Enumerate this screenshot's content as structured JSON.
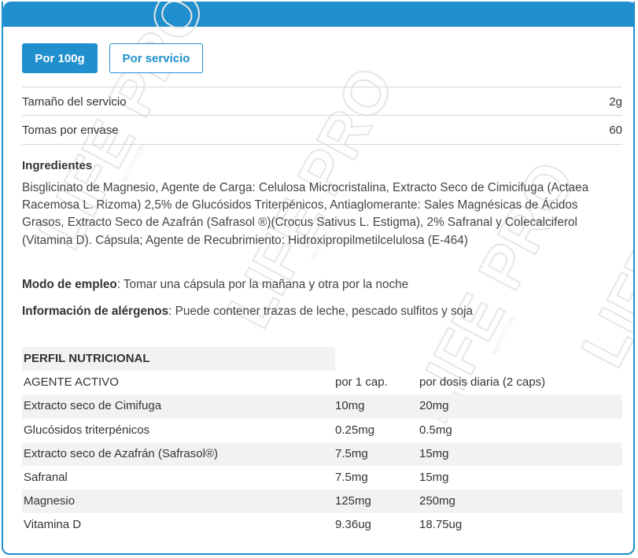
{
  "colors": {
    "accent": "#1f8fce",
    "row_alt": "#f2f2f2",
    "text": "#333333"
  },
  "tabs": [
    {
      "label": "Por 100g",
      "active": true
    },
    {
      "label": "Por servicio",
      "active": false
    }
  ],
  "serving": {
    "size_label": "Tamaño del servicio",
    "size_value": "2g",
    "doses_label": "Tomas por envase",
    "doses_value": "60"
  },
  "ingredients": {
    "heading": "Ingredientes",
    "text": "Bisglicinato de Magnesio, Agente de Carga: Celulosa Microcristalina, Extracto Seco de Cimicifuga (Actaea Racemosa L. Rizoma) 2,5% de Glucósidos Triterpénicos, Antiaglomerante: Sales Magnésicas de Ácidos Grasos, Extracto Seco de Azafrán (Safrasol ®)(Crocus Sativus L. Estigma), 2% Safranal y Colecalciferol (Vitamina D). Cápsula; Agente de Recubrimiento: Hidroxipropilmetilcelulosa (E-464)"
  },
  "usage": {
    "label": "Modo de empleo",
    "text": ": Tomar una cápsula por la mañana y otra por la noche"
  },
  "allergens": {
    "label": "Información de alérgenos",
    "text": ": Puede contener trazas de leche, pescado sulfitos y soja"
  },
  "profile": {
    "title": "PERFIL NUTRICIONAL",
    "headers": [
      "AGENTE ACTIVO",
      "por 1 cap.",
      "por dosis diaria (2 caps)"
    ],
    "rows": [
      [
        "Extracto seco de Cimifuga",
        "10mg",
        "20mg"
      ],
      [
        "Glucósidos triterpénicos",
        "0.25mg",
        "0.5mg"
      ],
      [
        "Extracto seco de Azafrán (Safrasol®)",
        "7.5mg",
        "15mg"
      ],
      [
        "Safranal",
        "7.5mg",
        "15mg"
      ],
      [
        "Magnesio",
        "125mg",
        "250mg"
      ],
      [
        "Vitamina D",
        "9.36ug",
        "18.75ug"
      ]
    ]
  },
  "watermark": {
    "brand": "LIFE PRO",
    "sub": "NUTRITION"
  }
}
